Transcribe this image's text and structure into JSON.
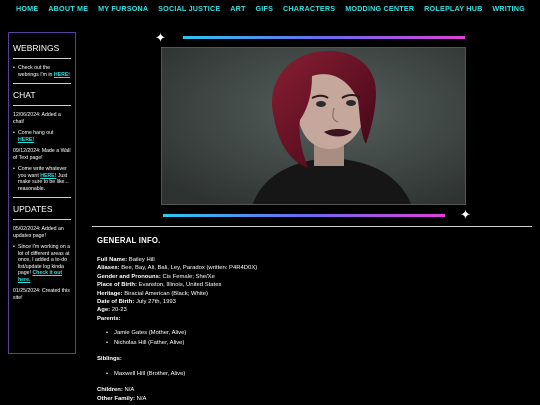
{
  "nav": [
    "HOME",
    "ABOUT ME",
    "MY FURSONA",
    "SOCIAL JUSTICE",
    "ART",
    "GIFS",
    "CHARACTERS",
    "MODDING CENTER",
    "ROLEPLAY HUB",
    "WRITING"
  ],
  "sidebar": {
    "webrings": {
      "title": "WEBRINGS",
      "item_text": "Check out the webrings I'm in",
      "item_link": "HERE!"
    },
    "chat": {
      "title": "CHAT",
      "update1": "12/06/2024: Added a chat!",
      "item1_text": "Come hang out",
      "item1_link": "HERE!",
      "update2": "09/12/2024: Made a Wall of Text page!",
      "item2_pre": "Come write whatever you want",
      "item2_link": "HERE!",
      "item2_post": "Just make sure to be like... reasonable."
    },
    "updates": {
      "title": "UPDATES",
      "update1": "05/02/2024: Added an updates page!",
      "item_text": "Since I'm working on a lot of different areas at once, I added a to-do list/update log kinda page!",
      "item_link": "Check it out here.",
      "update2": "01/25/2024: Created this site!"
    }
  },
  "content": {
    "section_title": "GENERAL INFO.",
    "fields": [
      {
        "label": "Full Name:",
        "value": "Bailey Hill"
      },
      {
        "label": "Aliases:",
        "value": "Bee, Bay, Ali, Bali, Ley, Paradox (written: P4R4D0X)"
      },
      {
        "label": "Gender and Pronouns:",
        "value": "Cis Female; She/Xe"
      },
      {
        "label": "Place of Birth:",
        "value": "Evanston, Illinois, United States"
      },
      {
        "label": "Heritage:",
        "value": "Biracial American (Black; White)"
      },
      {
        "label": "Date of Birth:",
        "value": "July 27th, 1993"
      },
      {
        "label": "Age:",
        "value": "20-23"
      }
    ],
    "parents_label": "Parents:",
    "parents": [
      "Jamie Gates (Mother, Alive)",
      "Nicholas Hill (Father, Alive)"
    ],
    "siblings_label": "Siblings:",
    "siblings": [
      "Maxwell Hill (Brother, Alive)"
    ],
    "children_label": "Children:",
    "children_value": "N/A",
    "other_label": "Other Family:",
    "other_value": "N/A"
  }
}
